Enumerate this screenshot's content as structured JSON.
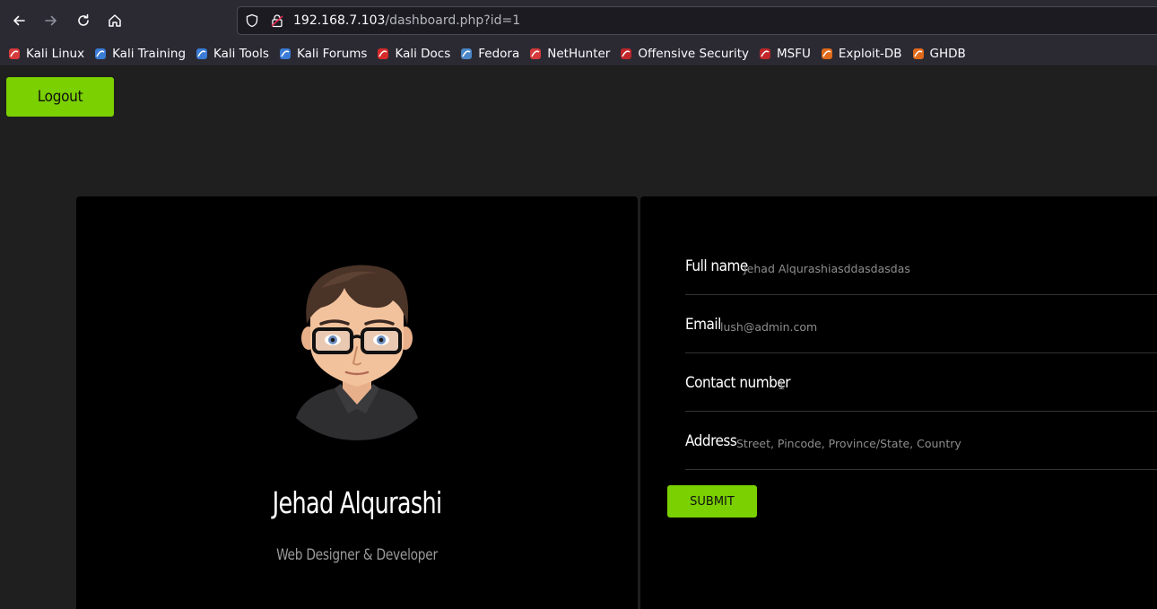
{
  "browser": {
    "url_host": "192.168.7.103",
    "url_path": "/dashboard.php?id=1",
    "bookmarks": [
      {
        "label": "Kali Linux",
        "icon": "kali-dragon-icon",
        "color": "#d63a3a"
      },
      {
        "label": "Kali Training",
        "icon": "kali-training-icon",
        "color": "#3a7bd5"
      },
      {
        "label": "Kali Tools",
        "icon": "kali-tools-icon",
        "color": "#3a7bd5"
      },
      {
        "label": "Kali Forums",
        "icon": "kali-forums-icon",
        "color": "#3a7bd5"
      },
      {
        "label": "Kali Docs",
        "icon": "kali-docs-icon",
        "color": "#d62b2b"
      },
      {
        "label": "Fedora",
        "icon": "fedora-icon",
        "color": "#4a86c8"
      },
      {
        "label": "NetHunter",
        "icon": "nethunter-icon",
        "color": "#d63a3a"
      },
      {
        "label": "Offensive Security",
        "icon": "offsec-icon",
        "color": "#c0262a"
      },
      {
        "label": "MSFU",
        "icon": "msfu-icon",
        "color": "#c0262a"
      },
      {
        "label": "Exploit-DB",
        "icon": "exploit-db-icon",
        "color": "#e06a1a"
      },
      {
        "label": "GHDB",
        "icon": "ghdb-icon",
        "color": "#e06a1a"
      }
    ]
  },
  "page": {
    "logout_label": "Logout",
    "accent_color": "#7ad000",
    "profile": {
      "name": "Jehad Alqurashi",
      "role": "Web Designer & Developer"
    },
    "form": {
      "fields": [
        {
          "label": "Full name",
          "value": "Jehad Alqurashiasddasdasdas"
        },
        {
          "label": "Email",
          "value": "lush@admin.com"
        },
        {
          "label": "Contact number",
          "value": "1"
        },
        {
          "label": "Address",
          "value": "Street, Pincode, Province/State, Country"
        }
      ],
      "submit_label": "SUBMIT"
    }
  }
}
